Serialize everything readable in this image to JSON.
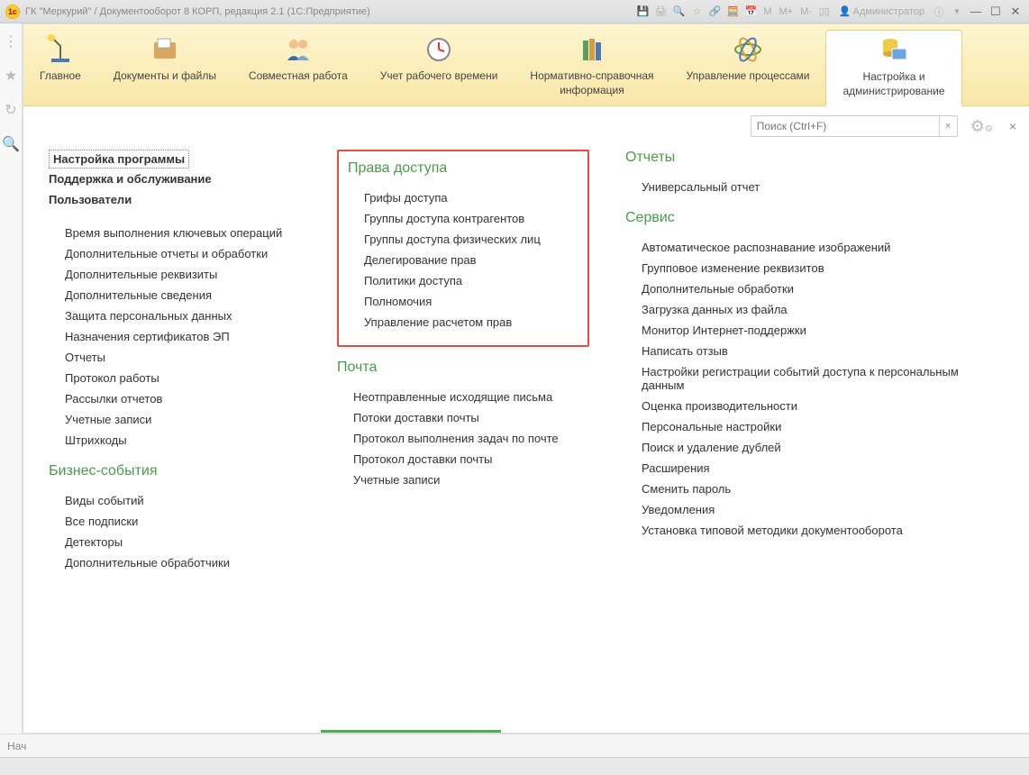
{
  "titlebar": {
    "logo_text": "1c",
    "title": "ГК \"Меркурий\" / Документооборот 8 КОРП, редакция 2.1  (1С:Предприятие)",
    "m_btn1": "M",
    "m_btn2": "M+",
    "m_btn3": "M-",
    "user": "Администратор"
  },
  "toolbar": {
    "tabs": [
      {
        "label": "Главное"
      },
      {
        "label": "Документы и файлы"
      },
      {
        "label": "Совместная работа"
      },
      {
        "label": "Учет рабочего времени"
      },
      {
        "label": "Нормативно-справочная\nинформация"
      },
      {
        "label": "Управление процессами"
      },
      {
        "label": "Настройка и\nадминистрирование"
      }
    ]
  },
  "search": {
    "placeholder": "Поиск (Ctrl+F)",
    "clear": "×",
    "close": "×"
  },
  "col1": {
    "bold1": "Настройка программы",
    "bold2": "Поддержка и обслуживание",
    "bold3": "Пользователи",
    "items1": [
      "Время выполнения ключевых операций",
      "Дополнительные отчеты и обработки",
      "Дополнительные реквизиты",
      "Дополнительные сведения",
      "Защита персональных данных",
      "Назначения сертификатов ЭП",
      "Отчеты",
      "Протокол работы",
      "Рассылки отчетов",
      "Учетные записи",
      "Штрихкоды"
    ],
    "section2": "Бизнес-события",
    "items2": [
      "Виды событий",
      "Все подписки",
      "Детекторы",
      "Дополнительные обработчики"
    ]
  },
  "col2": {
    "section1": "Права доступа",
    "items1": [
      "Грифы доступа",
      "Группы доступа контрагентов",
      "Группы доступа физических лиц",
      "Делегирование прав",
      "Политики доступа",
      "Полномочия",
      "Управление расчетом прав"
    ],
    "section2": "Почта",
    "items2": [
      "Неотправленные исходящие письма",
      "Потоки доставки почты",
      "Протокол выполнения задач по почте",
      "Протокол доставки почты",
      "Учетные записи"
    ]
  },
  "col3": {
    "section1": "Отчеты",
    "items1": [
      "Универсальный отчет"
    ],
    "section2": "Сервис",
    "items2": [
      "Автоматическое распознавание изображений",
      "Групповое изменение реквизитов",
      "Дополнительные обработки",
      "Загрузка данных из файла",
      "Монитор Интернет-поддержки",
      "Написать отзыв",
      "Настройки регистрации событий доступа к персональным данным",
      "Оценка производительности",
      "Персональные настройки",
      "Поиск и удаление дублей",
      "Расширения",
      "Сменить пароль",
      "Уведомления",
      "Установка типовой методики документооборота"
    ]
  },
  "bottom": {
    "label": "Нач"
  }
}
